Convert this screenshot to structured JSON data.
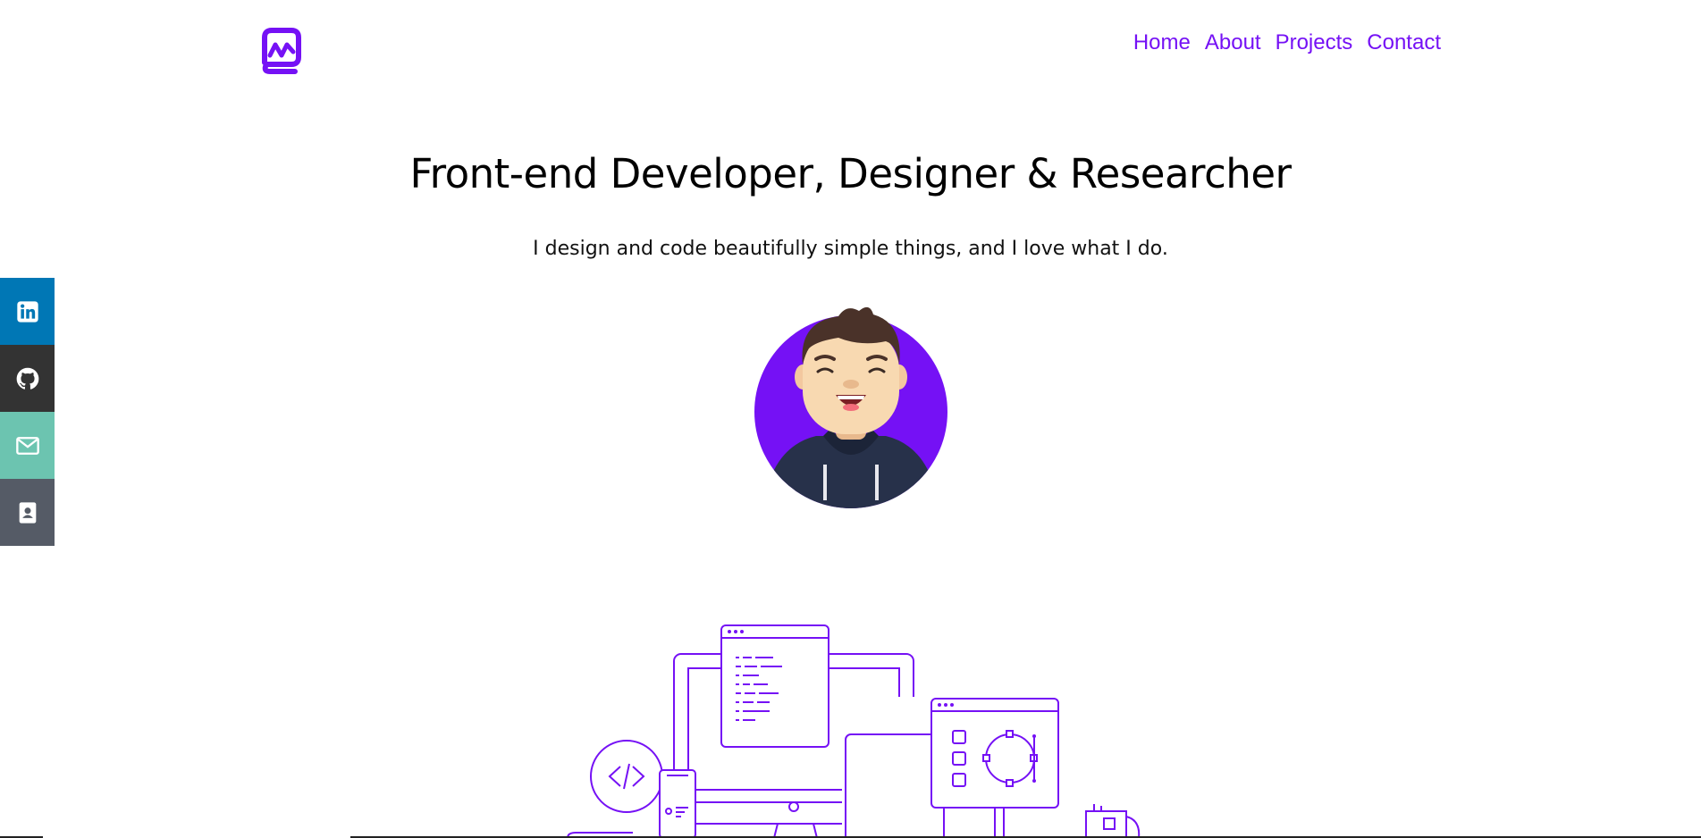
{
  "header": {
    "nav": [
      {
        "label": "Home"
      },
      {
        "label": "About"
      },
      {
        "label": "Projects"
      },
      {
        "label": "Contact"
      }
    ]
  },
  "hero": {
    "title": "Front-end Developer, Designer & Researcher",
    "subtitle": "I design and code beautifully simple things, and I love what I do."
  },
  "social": [
    {
      "name": "linkedin-icon",
      "color": "#0077b5"
    },
    {
      "name": "github-icon",
      "color": "#333333"
    },
    {
      "name": "mail-icon",
      "color": "#6cc4b0"
    },
    {
      "name": "contact-card-icon",
      "color": "#555b66"
    }
  ],
  "colors": {
    "accent": "#7511f5",
    "avatar_bg": "#7511f5"
  }
}
